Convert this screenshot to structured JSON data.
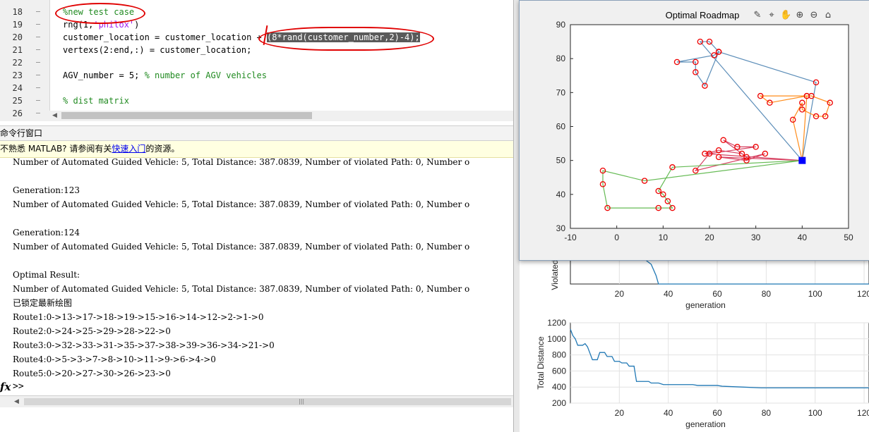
{
  "editor": {
    "lines": [
      {
        "num": "18",
        "code": "%new test case"
      },
      {
        "num": "19",
        "code_parts": [
          "rng(1,",
          "'philox'",
          ")"
        ]
      },
      {
        "num": "20",
        "code_parts": [
          "customer_location = customer_location + ",
          "(8*rand(customer_number,2)-4);"
        ]
      },
      {
        "num": "21",
        "code": "vertexs(2:end,:) = customer_location;"
      },
      {
        "num": "22",
        "code": ""
      },
      {
        "num": "23",
        "code_parts": [
          "AGV_number = 5; ",
          "% number of AGV vehicles"
        ]
      },
      {
        "num": "24",
        "code": ""
      },
      {
        "num": "25",
        "code": "% dist matrix"
      },
      {
        "num": "26",
        "code": ""
      }
    ]
  },
  "command_window": {
    "title": "命令行窗口",
    "tip_prefix": "不熟悉 MATLAB? 请参阅有关",
    "tip_link": "快速入门",
    "tip_suffix": "的资源。",
    "output": [
      "Number of Automated Guided Vehicle: 5, Total Distance: 387.0839, Number of violated Path: 0, Number o",
      "",
      "Generation:123",
      "Number of Automated Guided Vehicle: 5, Total Distance: 387.0839, Number of violated Path: 0, Number o",
      "",
      "Generation:124",
      "Number of Automated Guided Vehicle: 5, Total Distance: 387.0839, Number of violated Path: 0, Number o",
      "",
      "Optimal Result:",
      "Number of Automated Guided Vehicle: 5, Total Distance: 387.0839, Number of violated Path: 0, Number o",
      "已锁定最新绘图",
      "Route1:0->13->17->18->19->15->16->14->12->2->1->0",
      "Route2:0->24->25->29->28->22->0",
      "Route3:0->32->33->31->35->37->38->39->36->34->21->0",
      "Route4:0->5->3->7->8->10->11->9->6->4->0",
      "Route5:0->20->27->30->26->23->0"
    ],
    "prompt_fx": "fx",
    "prompt": ">>"
  },
  "figure": {
    "toolbar_icons": [
      "brush-icon",
      "data-cursor-icon",
      "pan-icon",
      "zoom-in-icon",
      "zoom-out-icon",
      "home-icon"
    ]
  },
  "chart_data": [
    {
      "type": "line",
      "title": "Optimal Roadmap",
      "xlim": [
        -10,
        50
      ],
      "ylim": [
        30,
        90
      ],
      "x_ticks": [
        -10,
        0,
        10,
        20,
        30,
        40,
        50
      ],
      "y_ticks": [
        30,
        40,
        50,
        60,
        70,
        80,
        90
      ],
      "depot": {
        "x": 40,
        "y": 50,
        "color": "#0000ff"
      },
      "routes": [
        {
          "color": "#5b8db8",
          "points": [
            [
              40,
              50
            ],
            [
              43,
              73
            ],
            [
              22,
              82
            ],
            [
              21,
              81
            ],
            [
              13,
              79
            ],
            [
              17,
              79
            ],
            [
              17,
              76
            ],
            [
              19,
              72
            ],
            [
              22,
              82
            ],
            [
              20,
              85
            ],
            [
              18,
              85
            ],
            [
              40,
              50
            ]
          ]
        },
        {
          "color": "#ff8c1a",
          "points": [
            [
              40,
              50
            ],
            [
              41,
              69
            ],
            [
              31,
              69
            ],
            [
              33,
              67
            ],
            [
              41,
              69
            ],
            [
              42,
              69
            ],
            [
              46,
              67
            ],
            [
              45,
              63
            ],
            [
              43,
              63
            ],
            [
              40,
              65
            ],
            [
              40,
              67
            ],
            [
              38,
              62
            ],
            [
              40,
              50
            ]
          ]
        },
        {
          "color": "#d64060",
          "points": [
            [
              40,
              50
            ],
            [
              19,
              52
            ],
            [
              22,
              53
            ],
            [
              27,
              52
            ],
            [
              28,
              51
            ],
            [
              23,
              56
            ],
            [
              26,
              54
            ],
            [
              30,
              54
            ],
            [
              20,
              52
            ],
            [
              17,
              47
            ],
            [
              32,
              52
            ],
            [
              28,
              50
            ],
            [
              22,
              51
            ],
            [
              40,
              50
            ]
          ]
        },
        {
          "color": "#66bb55",
          "points": [
            [
              40,
              50
            ],
            [
              12,
              48
            ],
            [
              9,
              41
            ],
            [
              10,
              40
            ],
            [
              11,
              38
            ],
            [
              12,
              36
            ],
            [
              9,
              36
            ],
            [
              -2,
              36
            ],
            [
              -3,
              43
            ],
            [
              -3,
              47
            ],
            [
              6,
              44
            ],
            [
              40,
              50
            ]
          ]
        }
      ]
    },
    {
      "type": "line",
      "xlabel": "generation",
      "ylabel": "Violated",
      "x_ticks": [
        20,
        40,
        60,
        80,
        100,
        120
      ],
      "xlim": [
        0,
        122
      ],
      "series": [
        {
          "color": "#1f77b4",
          "points": [
            [
              0,
              9
            ],
            [
              30,
              9
            ],
            [
              33,
              7
            ],
            [
              35,
              3
            ],
            [
              36,
              0
            ],
            [
              122,
              0
            ]
          ]
        }
      ]
    },
    {
      "type": "line",
      "xlabel": "generation",
      "ylabel": "Total Distance",
      "xlim": [
        0,
        122
      ],
      "ylim": [
        200,
        1200
      ],
      "x_ticks": [
        20,
        40,
        60,
        80,
        100,
        120
      ],
      "y_ticks": [
        200,
        400,
        600,
        800,
        1000,
        1200
      ],
      "series": [
        {
          "color": "#1f77b4",
          "points": [
            [
              0,
              1120
            ],
            [
              1,
              1040
            ],
            [
              2,
              1000
            ],
            [
              3,
              920
            ],
            [
              5,
              920
            ],
            [
              6,
              940
            ],
            [
              7,
              900
            ],
            [
              8,
              820
            ],
            [
              9,
              740
            ],
            [
              11,
              740
            ],
            [
              12,
              830
            ],
            [
              14,
              830
            ],
            [
              15,
              780
            ],
            [
              17,
              780
            ],
            [
              18,
              720
            ],
            [
              20,
              720
            ],
            [
              21,
              700
            ],
            [
              23,
              700
            ],
            [
              24,
              660
            ],
            [
              26,
              660
            ],
            [
              27,
              470
            ],
            [
              32,
              470
            ],
            [
              33,
              450
            ],
            [
              36,
              450
            ],
            [
              38,
              430
            ],
            [
              50,
              430
            ],
            [
              52,
              420
            ],
            [
              60,
              420
            ],
            [
              62,
              410
            ],
            [
              70,
              400
            ],
            [
              78,
              390
            ],
            [
              122,
              390
            ]
          ]
        }
      ]
    }
  ]
}
